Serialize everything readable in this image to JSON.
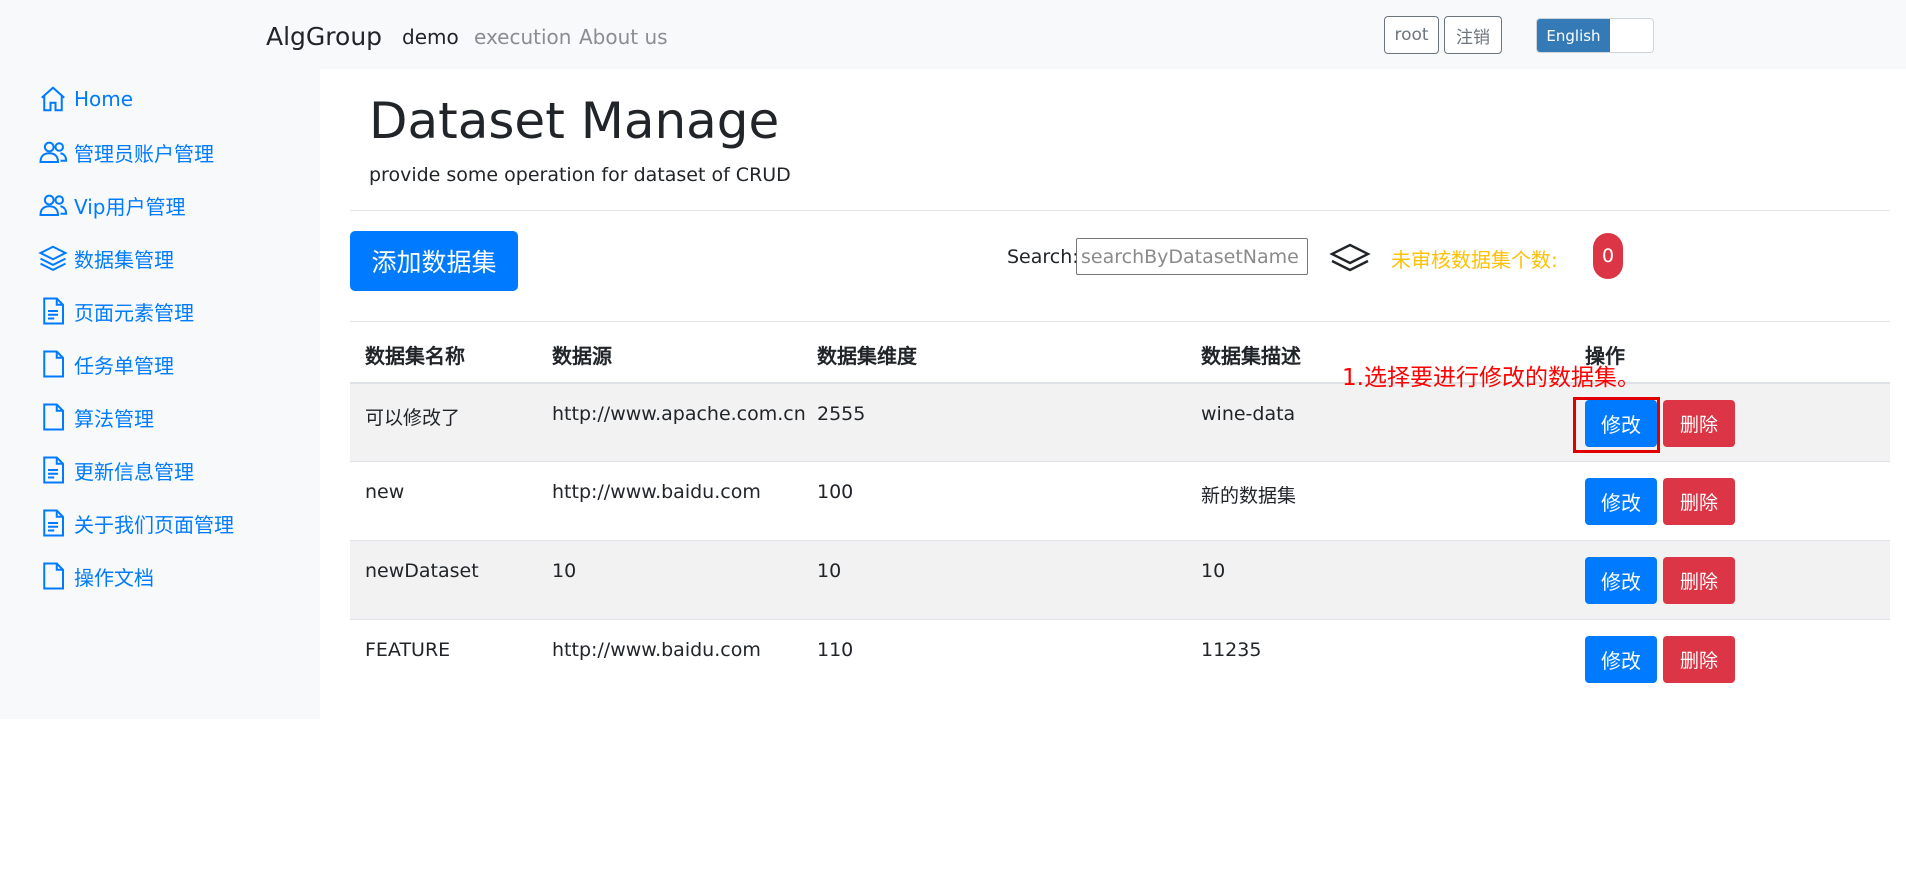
{
  "navbar": {
    "brand": "AlgGroup",
    "links": [
      "demo",
      "execution",
      "About us"
    ],
    "user_button": "root",
    "logout_button": "注销",
    "language": "English"
  },
  "sidebar": {
    "items": [
      {
        "label": "Home",
        "icon": "house-icon"
      },
      {
        "label": "管理员账户管理",
        "icon": "people-icon"
      },
      {
        "label": "Vip用户管理",
        "icon": "people-icon"
      },
      {
        "label": "数据集管理",
        "icon": "layers-icon"
      },
      {
        "label": "页面元素管理",
        "icon": "file-text-icon"
      },
      {
        "label": "任务单管理",
        "icon": "file-icon"
      },
      {
        "label": "算法管理",
        "icon": "file-icon"
      },
      {
        "label": "更新信息管理",
        "icon": "file-text-icon"
      },
      {
        "label": "关于我们页面管理",
        "icon": "file-text-icon"
      },
      {
        "label": "操作文档",
        "icon": "file-icon"
      }
    ]
  },
  "main": {
    "title": "Dataset Manage",
    "subtitle": "provide some operation for dataset of CRUD",
    "add_button": "添加数据集",
    "search_label": "Search:",
    "search_placeholder": "searchByDatasetName",
    "pending_label": "未审核数据集个数:",
    "pending_count": "0"
  },
  "table": {
    "headers": [
      "数据集名称",
      "数据源",
      "数据集维度",
      "数据集描述",
      "操作"
    ],
    "rows": [
      {
        "name": "可以修改了",
        "source": "http://www.apache.com.cn",
        "dimension": "2555",
        "description": "wine-data"
      },
      {
        "name": "new",
        "source": "http://www.baidu.com",
        "dimension": "100",
        "description": "新的数据集"
      },
      {
        "name": "newDataset",
        "source": "10",
        "dimension": "10",
        "description": "10"
      },
      {
        "name": "FEATURE",
        "source": "http://www.baidu.com",
        "dimension": "110",
        "description": "11235"
      }
    ],
    "edit_label": "修改",
    "delete_label": "删除"
  },
  "annotation": {
    "text": "1.选择要进行修改的数据集。"
  },
  "colors": {
    "primary": "#007bff",
    "danger": "#dc3545",
    "warning": "#ffc107",
    "annotation": "#ff0000",
    "toggle": "#337ab7"
  }
}
